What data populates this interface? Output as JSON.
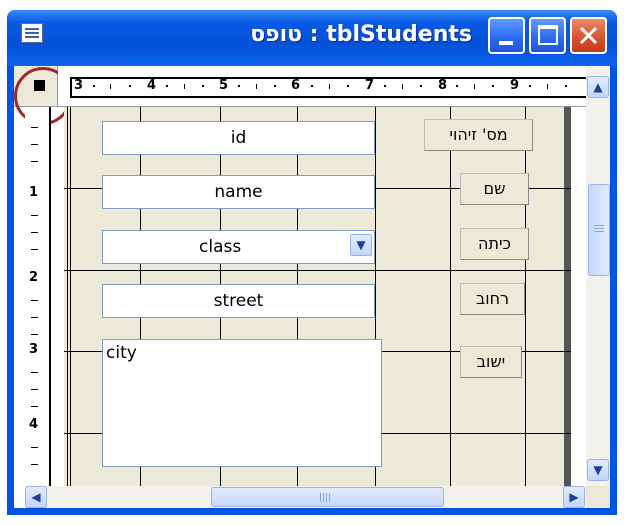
{
  "window": {
    "title": "טופס : tblStudents",
    "buttons": {
      "minimize": "_",
      "maximize": "□",
      "close": "✕"
    }
  },
  "ruler": {
    "horizontal_labels": [
      "3",
      "4",
      "5",
      "6",
      "7",
      "8",
      "9"
    ],
    "vertical_labels": [
      "1",
      "2",
      "3",
      "4"
    ]
  },
  "form": {
    "fields": [
      {
        "name": "id",
        "label": "מס' זיהוי"
      },
      {
        "name": "name",
        "label": "שם"
      },
      {
        "name": "class",
        "label": "כיתה"
      },
      {
        "name": "street",
        "label": "רחוב"
      },
      {
        "name": "city",
        "label": "ישוב"
      }
    ]
  },
  "icons": {
    "system": "form-window-icon",
    "scroll_up": "▲",
    "scroll_down": "▼",
    "scroll_left": "◀",
    "scroll_right": "▶",
    "dropdown": "▼"
  },
  "colors": {
    "titlebar": "#0a5ae6",
    "design_grid": "#ece9d8",
    "highlight_circle": "#9b2a2a"
  }
}
